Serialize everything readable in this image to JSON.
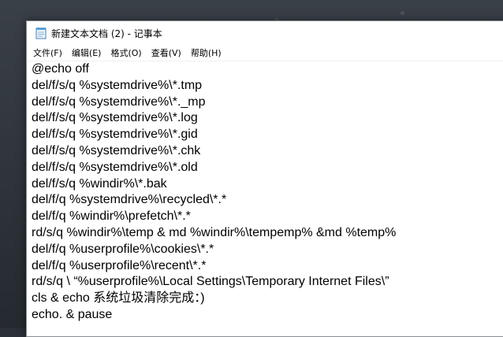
{
  "window": {
    "title": "新建文本文档 (2) - 记事本",
    "app_icon": "notepad-icon"
  },
  "menu": [
    {
      "label": "文件(F)"
    },
    {
      "label": "编辑(E)"
    },
    {
      "label": "格式(O)"
    },
    {
      "label": "查看(V)"
    },
    {
      "label": "帮助(H)"
    }
  ],
  "editor": {
    "lines": [
      "@echo off",
      "del/f/s/q %systemdrive%\\*.tmp",
      "del/f/s/q %systemdrive%\\*._mp",
      "del/f/s/q %systemdrive%\\*.log",
      "del/f/s/q %systemdrive%\\*.gid",
      "del/f/s/q %systemdrive%\\*.chk",
      "del/f/s/q %systemdrive%\\*.old",
      "del/f/s/q %windir%\\*.bak",
      "del/f/q %systemdrive%\\recycled\\*.*",
      "del/f/q %windir%\\prefetch\\*.*",
      "rd/s/q %windir%\\temp & md %windir%\\tempemp% &md %temp%",
      "del/f/q %userprofile%\\cookies\\*.*",
      "del/f/q %userprofile%\\recent\\*.*",
      "rd/s/q \\ “%userprofile%\\Local Settings\\Temporary Internet Files\\”",
      "cls & echo 系统垃圾清除完成：)",
      "echo. & pause"
    ]
  }
}
